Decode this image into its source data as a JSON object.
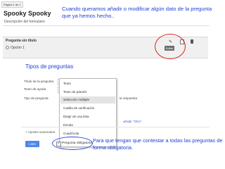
{
  "page_tab": "Página 1 de 1",
  "form": {
    "title": "Spooky Spooky",
    "description": "Descripción del formulario"
  },
  "question": {
    "title": "Pregunta sin título",
    "option1": "Opción 1",
    "edit_label": "Editar"
  },
  "annotations": {
    "top": "Cuando queramos añadir o modificar algún dato de la pregunta que ya hemos hecho..",
    "types": "Tipos de preguntas",
    "bottom": "Para que tengan que contestar a todas las preguntas de forma obligatoria."
  },
  "editor": {
    "label_title": "Título de la pregunta",
    "label_help": "Texto de ayuda",
    "label_type": "Tipo de pregunta",
    "response_text": "la respuesta",
    "add_other": "añadir \"Otro\"",
    "advanced": "+ Ajustes avanzados",
    "done": "Listo",
    "required": "Pregunta obligatoria",
    "types": [
      "Texto",
      "Texto de párrafo",
      "Selección múltiple",
      "Casilla de verificación",
      "Elegir de una lista",
      "Escala",
      "Cuadrícula"
    ],
    "selected_type": "Selección múltiple"
  },
  "colors": {
    "annotation": "#1e3fd8",
    "highlight_red": "#e02020",
    "highlight_blue": "#2a50d9",
    "done_button": "#4f86ec"
  },
  "icons": {
    "edit": "pencil-icon",
    "duplicate": "copy-icon",
    "delete": "trash-icon",
    "checkbox": "checkbox-icon",
    "radio": "radio-icon"
  }
}
